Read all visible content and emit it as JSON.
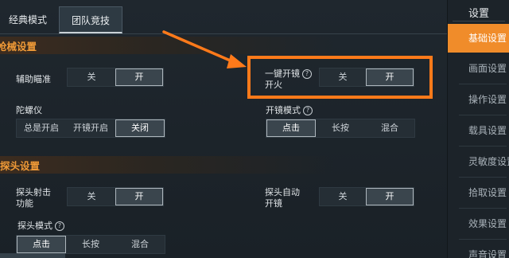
{
  "mode_tabs": [
    "经典模式",
    "团队竞技"
  ],
  "sections": {
    "weapon": "枪械设置",
    "peek": "探头设置"
  },
  "settings": {
    "aim_assist": {
      "label": "辅助瞄准",
      "options": [
        "关",
        "开"
      ],
      "selected": 1
    },
    "one_key_scope": {
      "label_line1": "一键开镜",
      "label_line2": "开火",
      "options": [
        "关",
        "开"
      ],
      "selected": 1
    },
    "gyro": {
      "label": "陀螺仪",
      "options": [
        "总是开启",
        "开镜开启",
        "关闭"
      ],
      "selected": 2
    },
    "scope_mode": {
      "label": "开镜模式",
      "options": [
        "点击",
        "长按",
        "混合"
      ],
      "selected": 0
    },
    "peek_fire": {
      "label_line1": "探头射击",
      "label_line2": "功能",
      "options": [
        "关",
        "开"
      ],
      "selected": 1
    },
    "peek_auto_scope": {
      "label_line1": "探头自动",
      "label_line2": "开镜",
      "options": [
        "关",
        "开"
      ],
      "selected": 1
    },
    "peek_mode": {
      "label": "探头模式",
      "options": [
        "点击",
        "长按",
        "混合"
      ],
      "selected": 0
    }
  },
  "right_panel": {
    "title": "设置",
    "items": [
      "基础设置",
      "画面设置",
      "操作设置",
      "载具设置",
      "灵敏度设置",
      "拾取设置",
      "效果设置",
      "声音设置"
    ],
    "active": 0
  },
  "help_glyph": "?",
  "colors": {
    "accent": "#f08c2a",
    "highlight": "#ff7a1a",
    "section_text": "#f09a37"
  }
}
